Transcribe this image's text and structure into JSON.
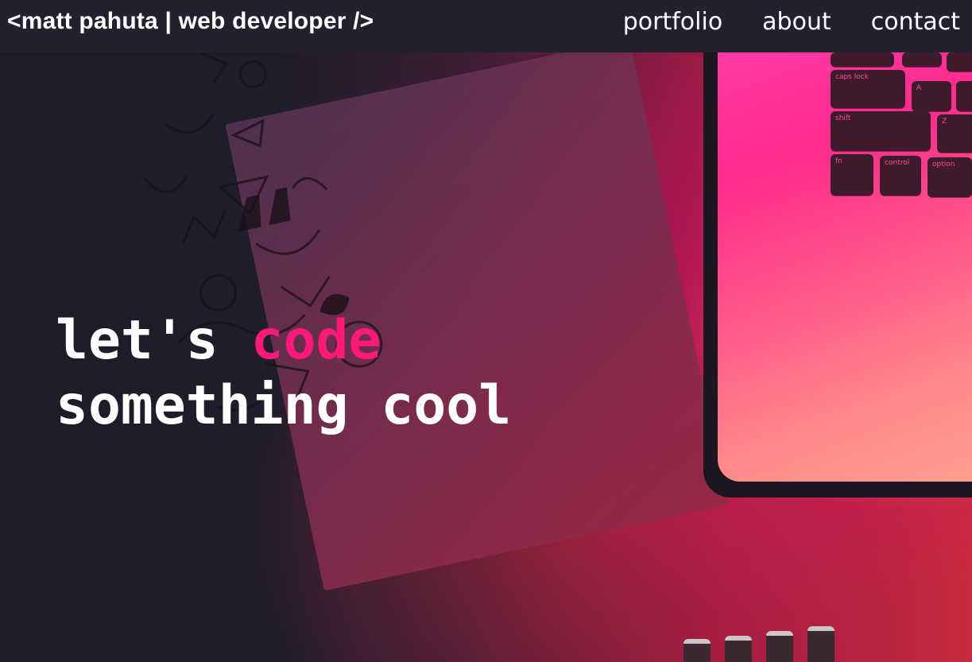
{
  "nav": {
    "brand": "<matt pahuta | web developer />",
    "links": [
      {
        "label": "portfolio"
      },
      {
        "label": "about"
      },
      {
        "label": "contact"
      }
    ]
  },
  "hero": {
    "line1_prefix": "let's",
    "line1_accent": "code",
    "line2": "something cool",
    "background_image": "desk-with-doodle-notebook-and-pink-lit-laptop"
  },
  "colors": {
    "accent": "#ff1a7a",
    "navbar_bg": "#222130",
    "text": "#ffffff"
  }
}
